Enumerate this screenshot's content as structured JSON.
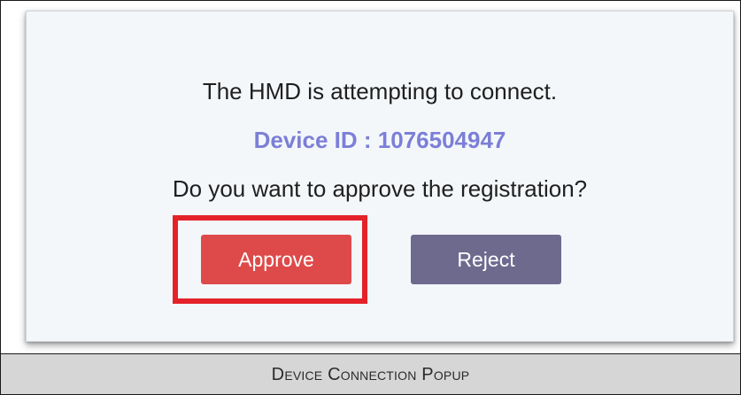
{
  "dialog": {
    "message": "The HMD is attempting to connect.",
    "device_id": "Device ID : 1076504947",
    "question": "Do you want to approve the registration?",
    "approve_label": "Approve",
    "reject_label": "Reject"
  },
  "caption": {
    "text": "Device Connection Popup"
  },
  "colors": {
    "dialog_background": "#f4f7fa",
    "device_id_text": "#7b7fd6",
    "approve_button": "#de4a4a",
    "reject_button": "#6d6a8e",
    "highlight_border": "#e3222a",
    "caption_background": "#d6d6d6"
  }
}
